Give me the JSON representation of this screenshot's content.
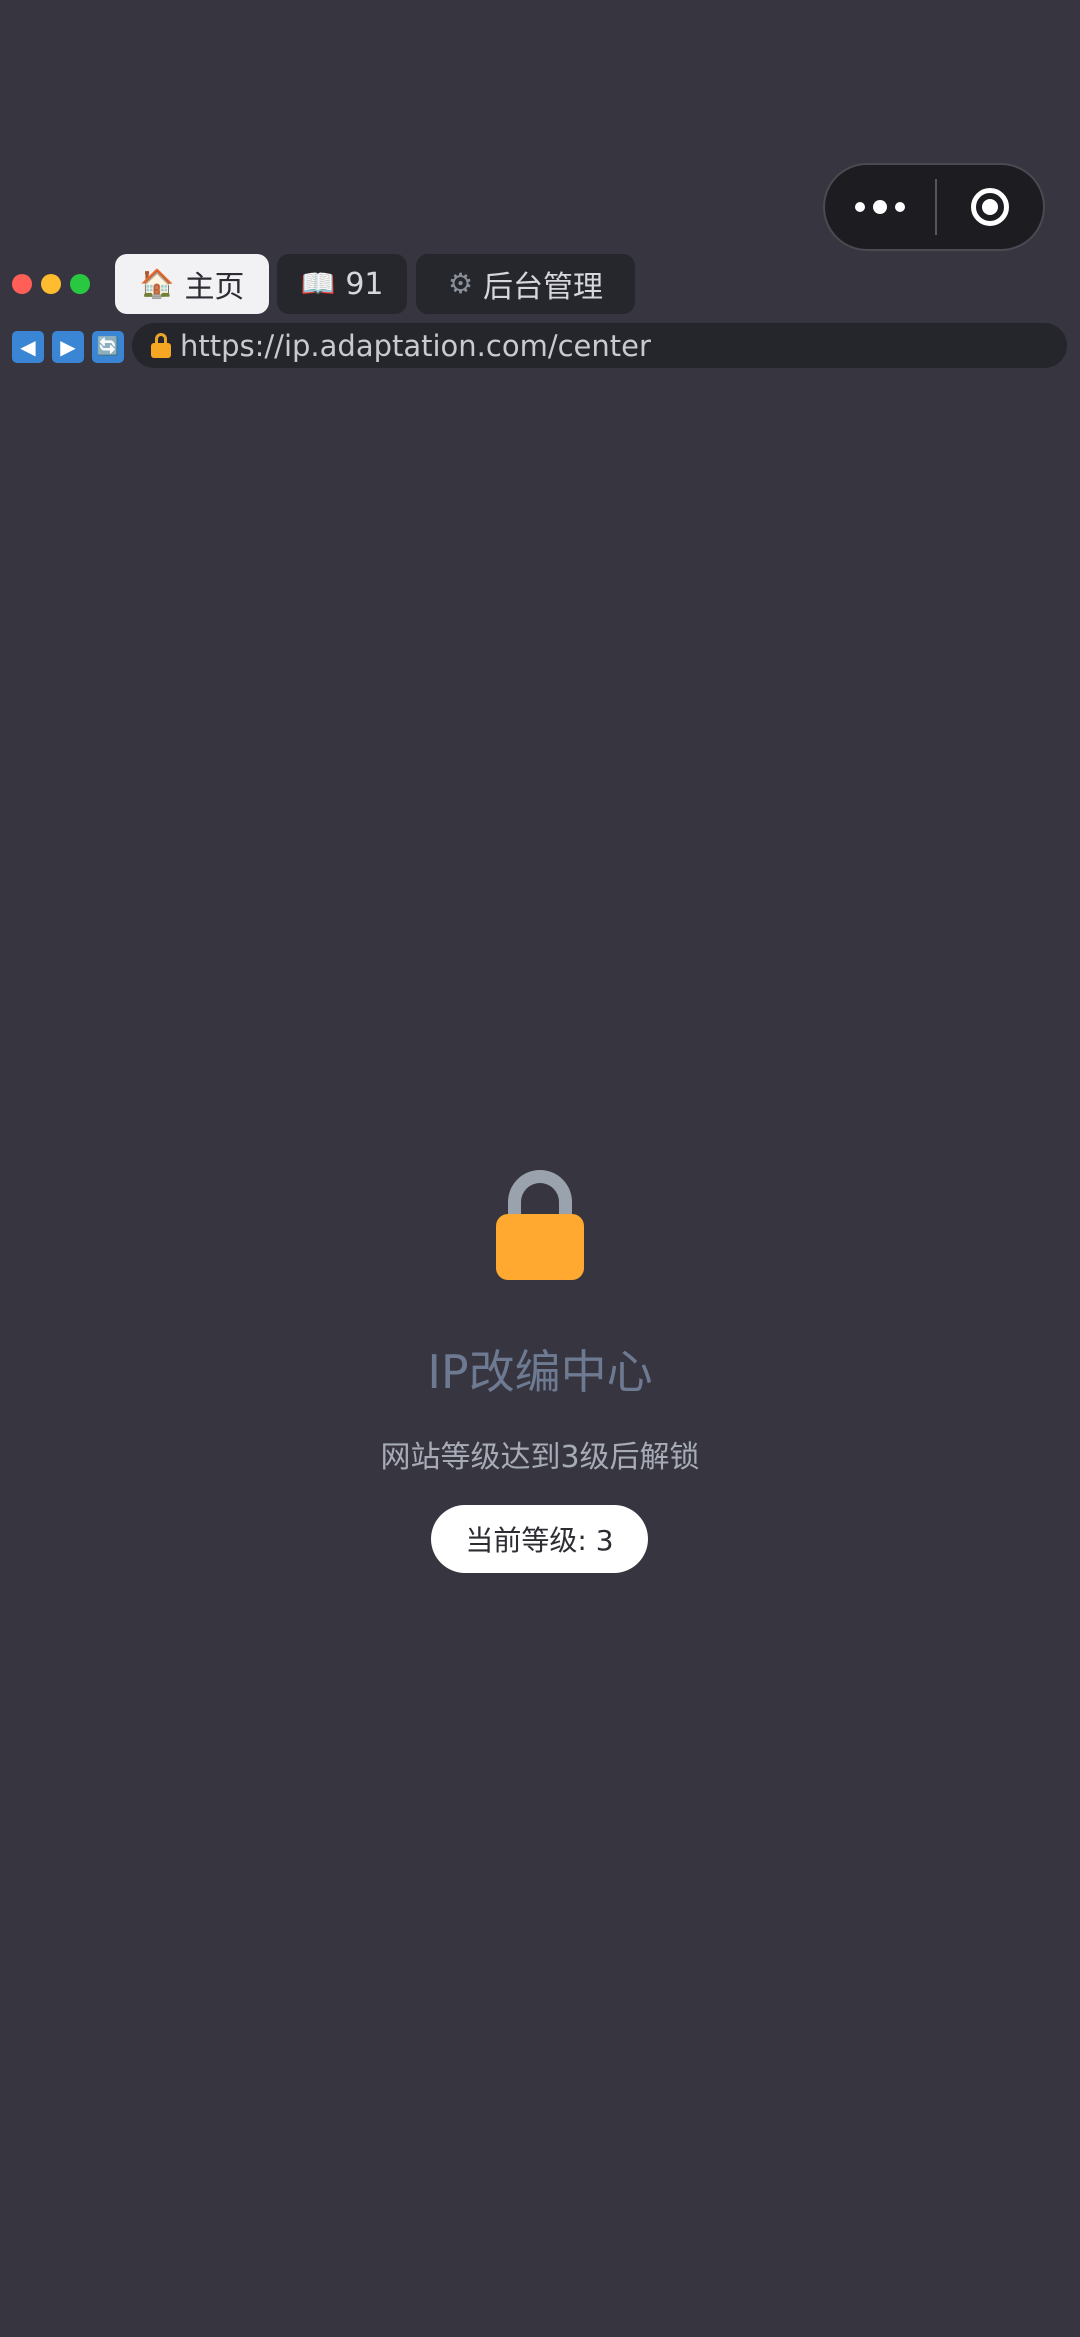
{
  "browser": {
    "tabs": [
      {
        "icon": "🏠",
        "label": "主页",
        "active": true
      },
      {
        "icon": "📖",
        "label": "91",
        "active": false
      },
      {
        "icon": "⚙",
        "label": "后台管理",
        "active": false
      }
    ],
    "nav": {
      "back": "◀",
      "forward": "▶",
      "refresh": "🔄"
    },
    "url": "https://ip.adaptation.com/center"
  },
  "locked_panel": {
    "title": "IP改编中心",
    "subtitle": "网站等级达到3级后解锁",
    "level_label": "当前等级: 3"
  },
  "colors": {
    "background": "#363540",
    "lock_body": "#ffa930",
    "lock_shackle": "#9aa3ad",
    "title": "#6e7a92",
    "nav_button": "#3a86d4"
  }
}
